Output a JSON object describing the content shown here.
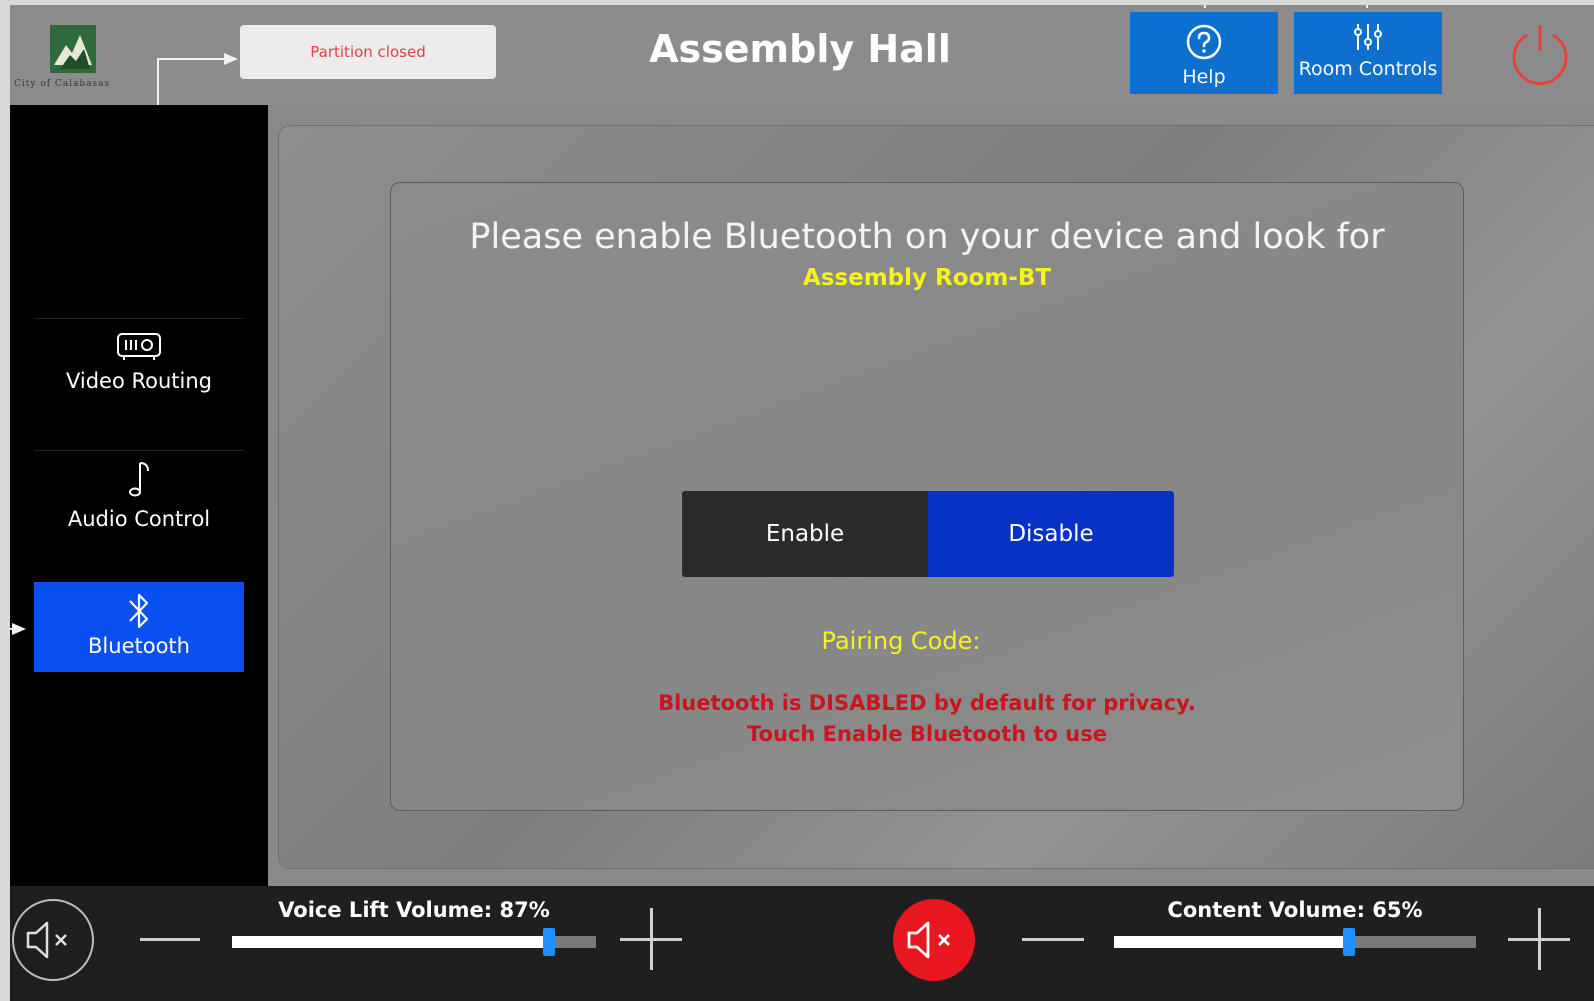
{
  "header": {
    "logo_text": "City of Calabasas",
    "partition_status": "Partition closed",
    "title": "Assembly Hall",
    "help_label": "Help",
    "help_icon": "help-circle-icon",
    "room_controls_label": "Room Controls",
    "room_controls_icon": "sliders-icon",
    "power_icon": "power-icon"
  },
  "sidebar": {
    "items": [
      {
        "label": "Video Routing",
        "icon": "projector-icon",
        "active": false
      },
      {
        "label": "Audio Control",
        "icon": "music-note-icon",
        "active": false
      },
      {
        "label": "Bluetooth",
        "icon": "bluetooth-icon",
        "active": true
      }
    ]
  },
  "main": {
    "instruction": "Please enable Bluetooth on your device and look for",
    "device_name": "Assembly Room-BT",
    "enable_label": "Enable",
    "disable_label": "Disable",
    "selected_state": "Disable",
    "pairing_label": "Pairing Code:",
    "warning_line1": "Bluetooth is DISABLED by default for privacy.",
    "warning_line2": "Touch Enable Bluetooth to use"
  },
  "footer": {
    "voice_lift": {
      "label": "Voice Lift Volume: 87%",
      "level_percent": 87
    },
    "content": {
      "label": "Content Volume: 65%",
      "level_percent": 65
    },
    "mute_left_icon": "speaker-mute-icon",
    "mute_center_icon": "speaker-mute-icon",
    "minus_icon": "minus-icon",
    "plus_icon": "plus-icon"
  },
  "colors": {
    "accent_blue": "#0d6fcf",
    "active_nav": "#0a4ff0",
    "disable_selected": "#0831c8",
    "highlight_yellow": "#f6f21b",
    "warning_red": "#c8161c",
    "mute_red": "#e8161e",
    "power_red": "#e8403a"
  }
}
